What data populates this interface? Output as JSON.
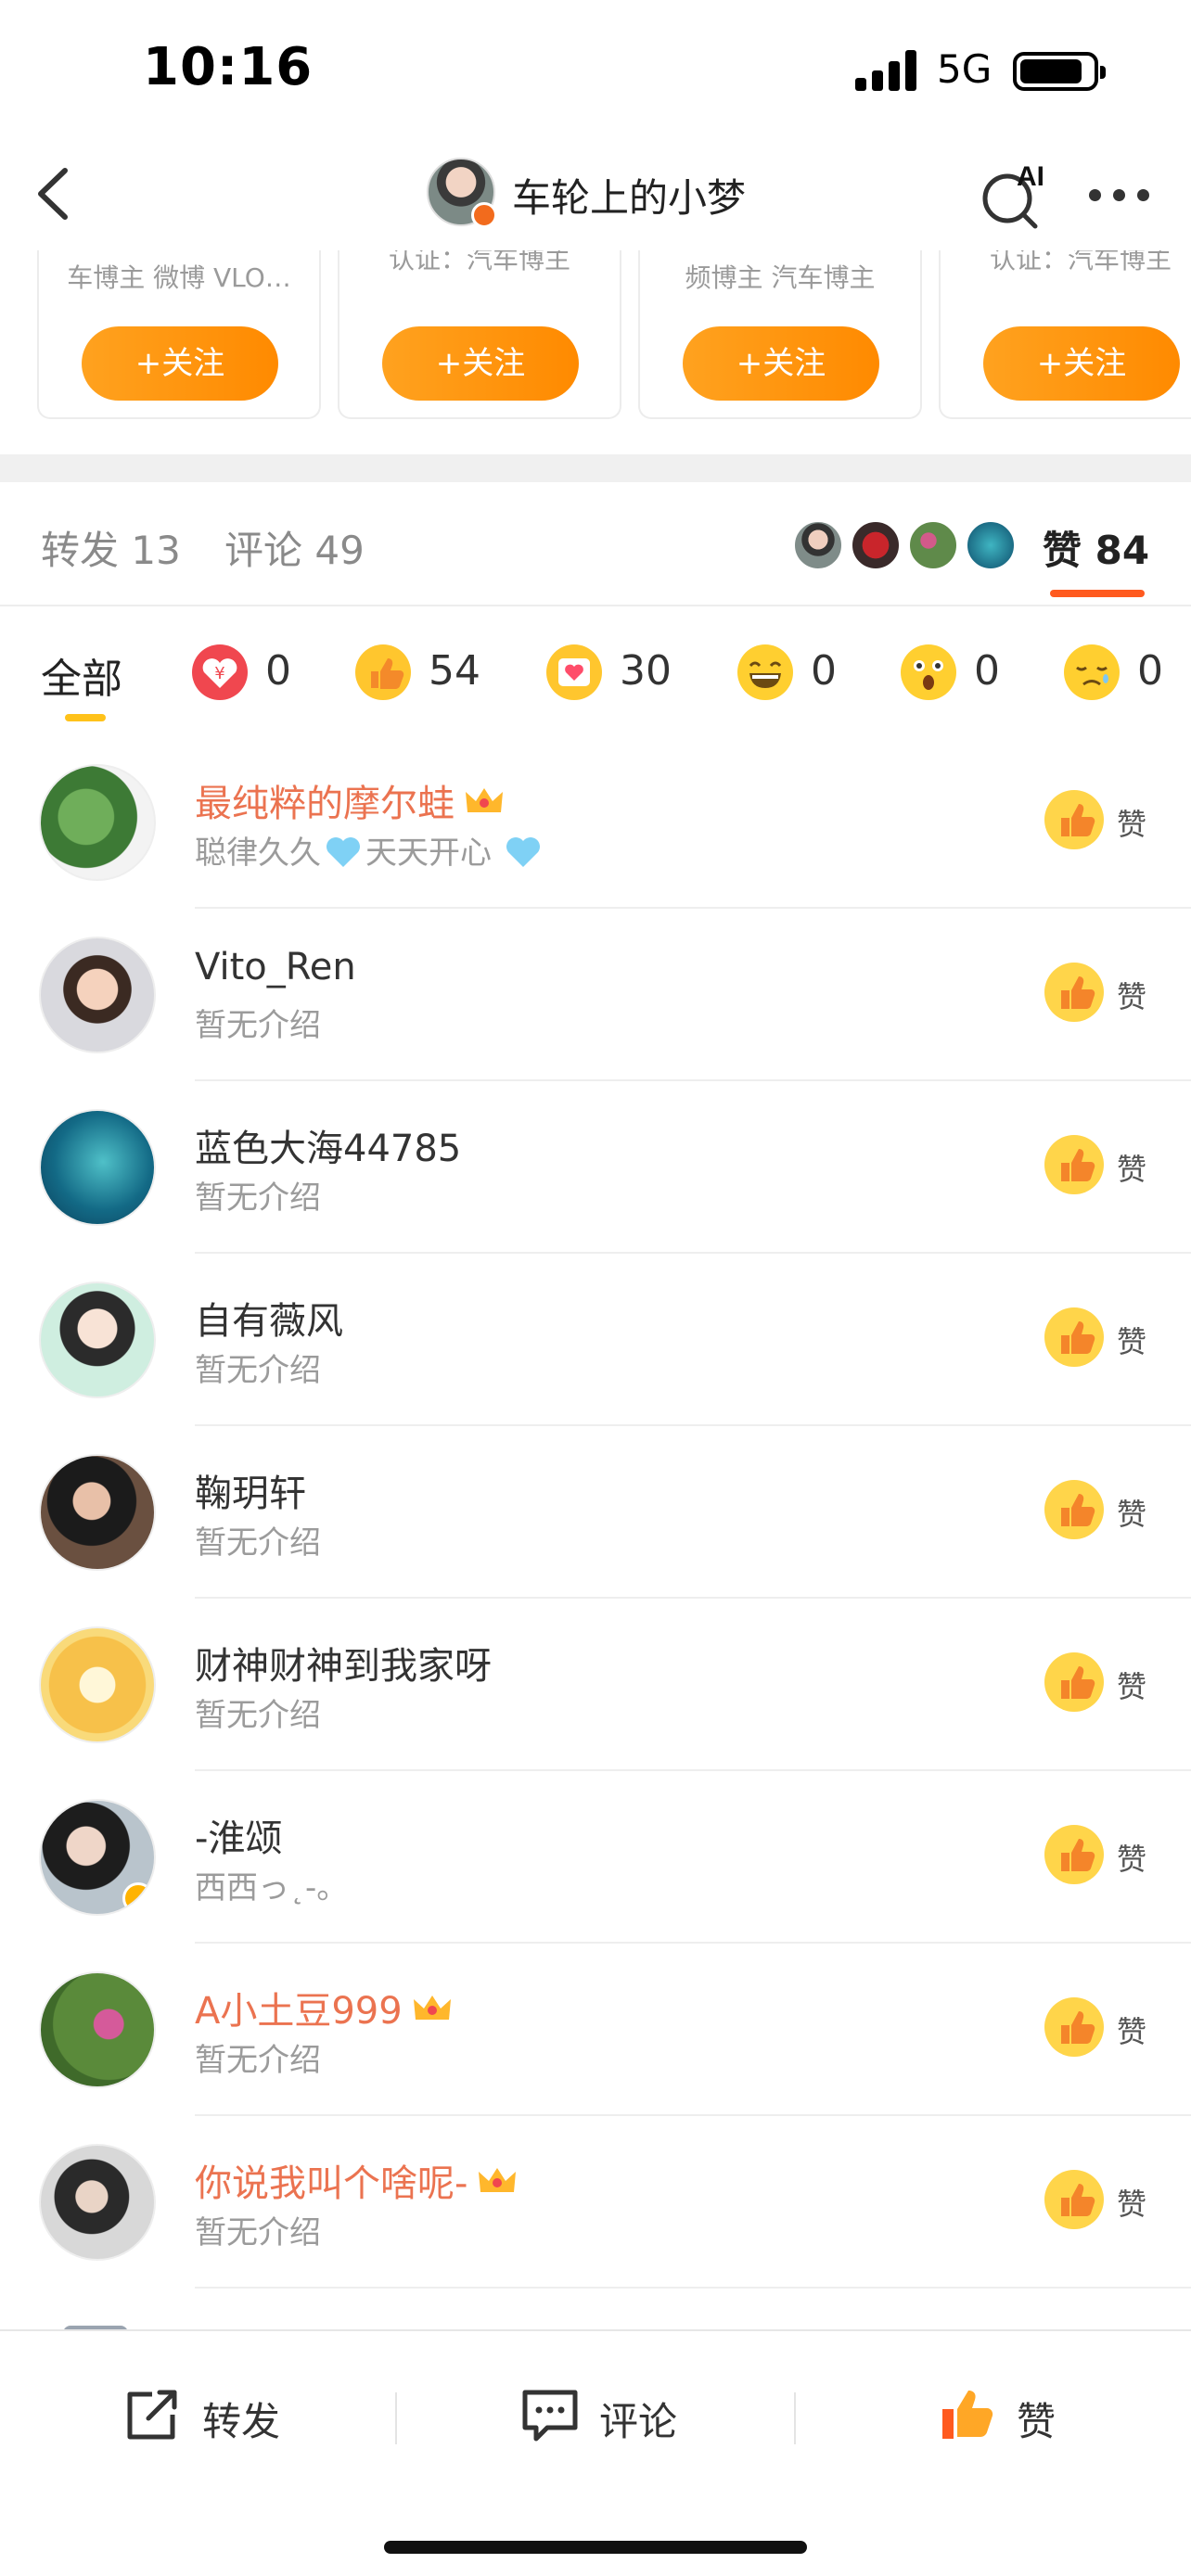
{
  "status_bar": {
    "time": "10:16",
    "network": "5G"
  },
  "nav": {
    "title": "车轮上的小梦",
    "ai_label": "AI"
  },
  "recommend_cards": [
    {
      "desc": "车博主 微博 VLO…",
      "follow": "+关注"
    },
    {
      "desc": "认证：汽车博主",
      "follow": "+关注"
    },
    {
      "desc": "频博主 汽车博主",
      "follow": "+关注"
    },
    {
      "desc": "认证：汽车博主",
      "follow": "+关注"
    }
  ],
  "tabs": {
    "repost": "转发 13",
    "comment": "评论 49",
    "like": "赞 84"
  },
  "reactions": {
    "all_label": "全部",
    "items": [
      {
        "icon": "red-envelope-icon",
        "count": "0",
        "color": "#f0474f"
      },
      {
        "icon": "thumbs-up-icon",
        "count": "54",
        "color": "#ffc62e"
      },
      {
        "icon": "heart-icon",
        "count": "30",
        "color": "#ffc62e"
      },
      {
        "icon": "laughing-face-icon",
        "count": "0",
        "color": "#ffcf30"
      },
      {
        "icon": "surprised-face-icon",
        "count": "0",
        "color": "#ffcf30"
      },
      {
        "icon": "sad-face-icon",
        "count": "0",
        "color": "#ffcf30"
      }
    ]
  },
  "likers": [
    {
      "name": "最纯粹的摩尔蛙",
      "bio_a": "聪律久久",
      "bio_b": "天天开心",
      "vip": true
    },
    {
      "name": "Vito_Ren",
      "bio": "暂无介绍",
      "vip": false
    },
    {
      "name": "蓝色大海44785",
      "bio": "暂无介绍",
      "vip": false
    },
    {
      "name": "自有薇风",
      "bio": "暂无介绍",
      "vip": false
    },
    {
      "name": "鞠玥轩",
      "bio": "暂无介绍",
      "vip": false
    },
    {
      "name": "财神财神到我家呀",
      "bio": "暂无介绍",
      "vip": false
    },
    {
      "name": "-淮颂",
      "bio": "西西っ˛-。",
      "vip": false,
      "verified": true
    },
    {
      "name": "A小土豆999",
      "bio": "暂无介绍",
      "vip": true
    },
    {
      "name": "你说我叫个啥呢-",
      "bio": "暂无介绍",
      "vip": true
    }
  ],
  "like_button_label": "赞",
  "bottom_bar": {
    "repost": "转发",
    "comment": "评论",
    "like": "赞"
  },
  "colors": {
    "brand_orange": "#ff8a00",
    "vip_name": "#eb7350",
    "like_underline": "#ff5a1f"
  }
}
